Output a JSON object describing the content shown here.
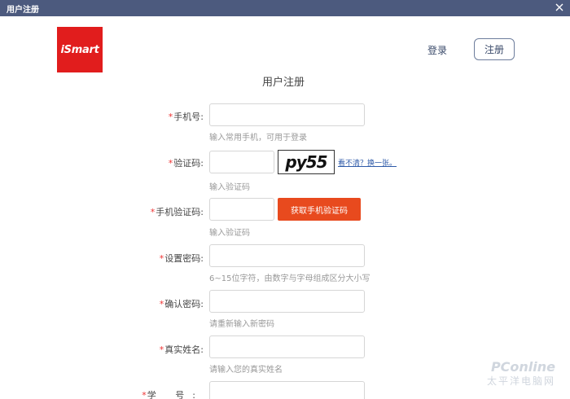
{
  "window": {
    "title": "用户注册"
  },
  "header": {
    "logo": "iSmart",
    "login_label": "登录",
    "register_label": "注册"
  },
  "form": {
    "title": "用户注册",
    "phone": {
      "label": "手机号:",
      "hint": "输入常用手机，可用于登录"
    },
    "captcha": {
      "label": "验证码:",
      "hint": "输入验证码",
      "image_text": "py55",
      "refresh_label": "看不清？换一张。"
    },
    "sms": {
      "label": "手机验证码:",
      "hint": "输入验证码",
      "button_label": "获取手机验证码"
    },
    "password": {
      "label": "设置密码:",
      "hint": "6~15位字符，由数字与字母组成区分大小写"
    },
    "confirm": {
      "label": "确认密码:",
      "hint": "请重新输入新密码"
    },
    "realname": {
      "label": "真实姓名:",
      "hint": "请输入您的真实姓名"
    },
    "student_id": {
      "label": "学 号:"
    }
  },
  "watermark": {
    "main": "PConline",
    "sub": "太平洋电脑网"
  },
  "colors": {
    "titlebar": "#4c5a7e",
    "logo": "#e11d1d",
    "accent_button": "#e84a1e",
    "required_star": "#ee3333"
  }
}
